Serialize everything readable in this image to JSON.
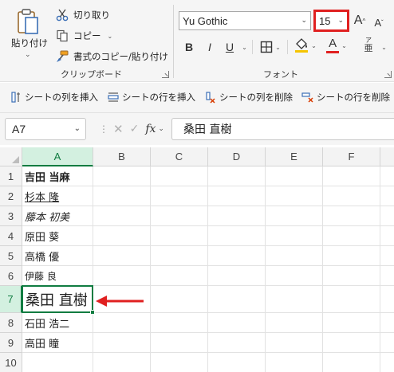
{
  "ribbon": {
    "clipboard": {
      "paste_label": "貼り付け",
      "cut_label": "切り取り",
      "copy_label": "コピー",
      "format_painter_label": "書式のコピー/貼り付け",
      "group_label": "クリップボード"
    },
    "font": {
      "family": "Yu Gothic",
      "size": "15",
      "group_label": "フォント",
      "bold": "B",
      "italic": "I",
      "underline": "U",
      "font_color_glyph": "A",
      "grow_glyph": "A",
      "shrink_glyph": "A",
      "phonetic_glyph": "ア",
      "phonetic_sub": "亜",
      "highlight_color": "#e02020",
      "font_color": "#e02020",
      "fill_color": "#f5c400"
    }
  },
  "cells_bar": {
    "insert_column": "シートの列を挿入",
    "insert_row": "シートの行を挿入",
    "delete_column": "シートの列を削除",
    "delete_row": "シートの行を削除"
  },
  "formula_bar": {
    "name_box": "A7",
    "fx_label": "fx",
    "content": "桑田 直樹"
  },
  "grid": {
    "columns": [
      "A",
      "B",
      "C",
      "D",
      "E",
      "F"
    ],
    "rows": [
      "1",
      "2",
      "3",
      "4",
      "5",
      "6",
      "7",
      "8",
      "9",
      "10"
    ],
    "cells": {
      "a1": "吉田 当麻",
      "a2": "杉本 隆",
      "a3": "藤本 初美",
      "a4": "原田 葵",
      "a5": "高橋 優",
      "a6": "伊藤 良",
      "a7": "桑田 直樹",
      "a8": "石田 浩二",
      "a9": "高田 瞳"
    },
    "selected_cell": "A7",
    "accent_color": "#107c41",
    "arrow_color": "#e02020"
  }
}
